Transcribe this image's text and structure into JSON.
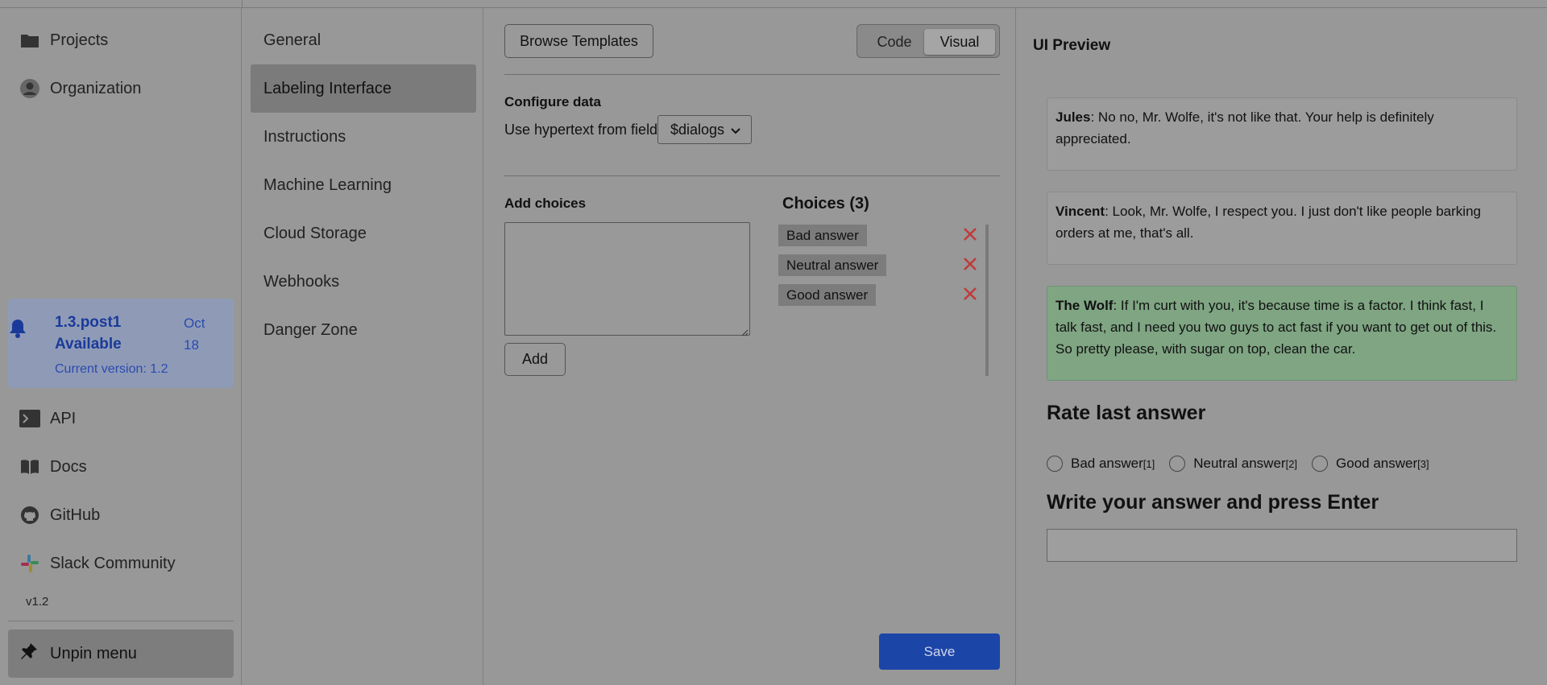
{
  "left_nav": {
    "projects": "Projects",
    "organization": "Organization",
    "update": {
      "version": "1.3.post1",
      "available": "Available",
      "date_month": "Oct",
      "date_day": "18",
      "current": "Current version: 1.2"
    },
    "api": "API",
    "docs": "Docs",
    "github": "GitHub",
    "slack": "Slack Community",
    "version": "v1.2",
    "unpin": "Unpin menu"
  },
  "settings_nav": {
    "items": [
      "General",
      "Labeling Interface",
      "Instructions",
      "Machine Learning",
      "Cloud Storage",
      "Webhooks",
      "Danger Zone"
    ],
    "active_index": 1
  },
  "editor": {
    "browse_templates": "Browse Templates",
    "mode_code": "Code",
    "mode_visual": "Visual",
    "configure_data": "Configure data",
    "hypertext_label": "Use hypertext from field",
    "field_select": "$dialogs",
    "add_choices": "Add choices",
    "add_button": "Add",
    "choices_title": "Choices (3)",
    "choices": [
      "Bad answer",
      "Neutral answer",
      "Good answer"
    ],
    "save": "Save"
  },
  "preview": {
    "title": "UI Preview",
    "messages": [
      {
        "speaker": "Jules",
        "text": ": No no, Mr. Wolfe, it's not like that. Your help is definitely appreciated."
      },
      {
        "speaker": "Vincent",
        "text": ": Look, Mr. Wolfe, I respect you. I just don't like people barking orders at me, that's all."
      },
      {
        "speaker": "The Wolf",
        "text": ": If I'm curt with you, it's because time is a factor. I think fast, I talk fast, and I need you two guys to act fast if you want to get out of this. So pretty please, with sugar on top, clean the car."
      }
    ],
    "rate_heading": "Rate last answer",
    "radios": [
      {
        "label": "Bad answer",
        "hotkey": "[1]"
      },
      {
        "label": "Neutral answer",
        "hotkey": "[2]"
      },
      {
        "label": "Good answer",
        "hotkey": "[3]"
      }
    ],
    "write_heading": "Write your answer and press Enter",
    "answer_value": ""
  },
  "colors": {
    "overlay_bg": "#989898",
    "save_blue": "#1c45a8",
    "close_red": "#c0393b",
    "highlight_green": "#7fa583"
  }
}
